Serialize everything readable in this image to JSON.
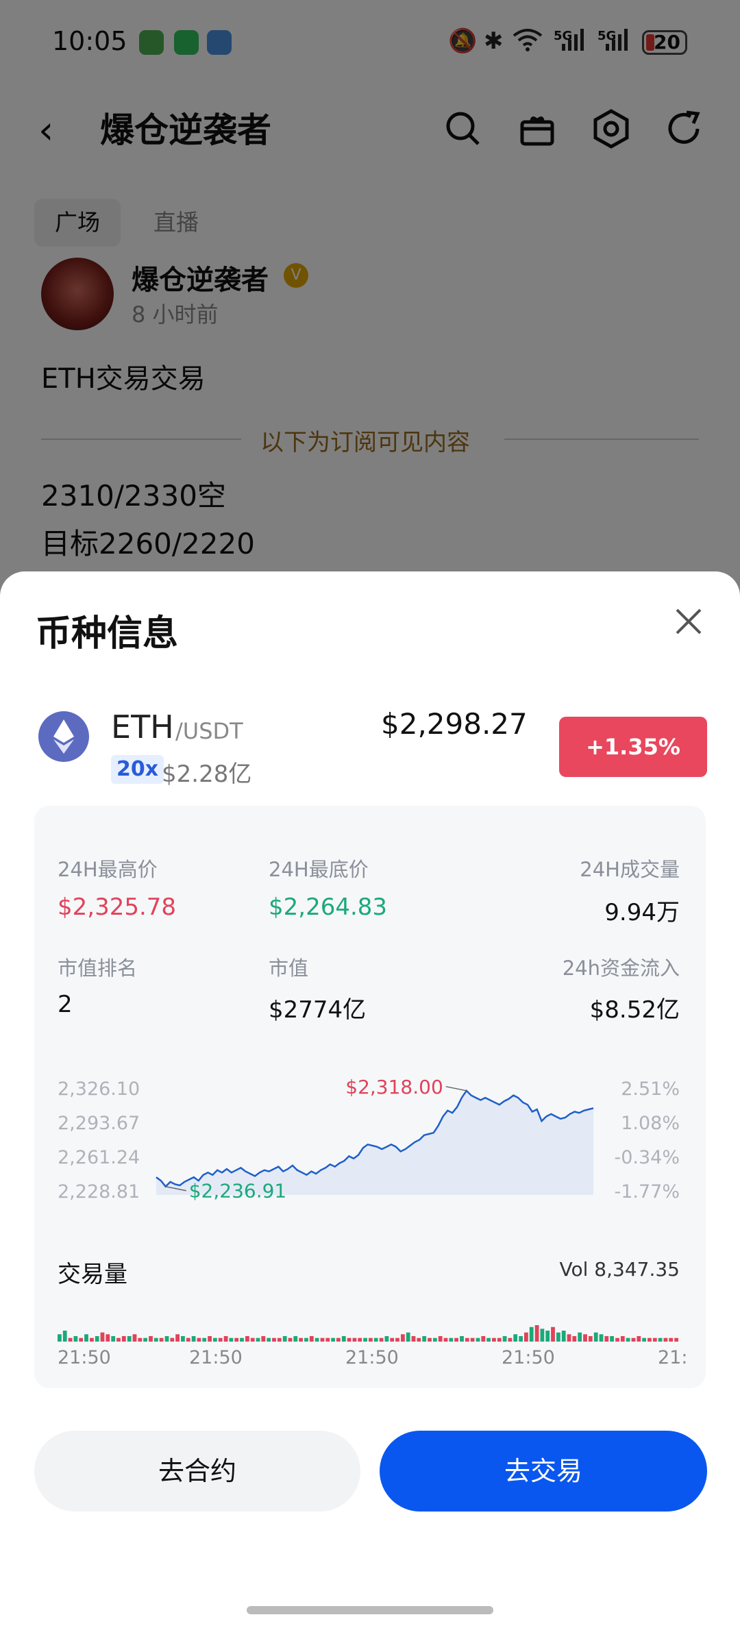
{
  "status": {
    "time": "10:05",
    "net1": "5G",
    "net2": "5G",
    "battery": "20"
  },
  "nav": {
    "back": "‹",
    "title": "爆仓逆袭者"
  },
  "tabs": [
    "广场",
    "直播"
  ],
  "post": {
    "author": "爆仓逆袭者",
    "time": "8 小时前",
    "title": "ETH交易交易",
    "subscriber_label": "以下为订阅可见内容",
    "line1": "2310/2330空",
    "line2": "目标2260/2220"
  },
  "sheet": {
    "title": "币种信息",
    "coin": {
      "symbol": "ETH",
      "pair": "/USDT",
      "leverage": "20x",
      "volume": "$2.28亿",
      "price": "$2,298.27",
      "change": "+1.35%"
    },
    "stats": {
      "high_label": "24H最高价",
      "high_value": "$2,325.78",
      "low_label": "24H最底价",
      "low_value": "$2,264.83",
      "vol_label": "24H成交量",
      "vol_value": "9.94万",
      "rank_label": "市值排名",
      "rank_value": "2",
      "cap_label": "市值",
      "cap_value": "$2774亿",
      "inflow_label": "24h资金流入",
      "inflow_value": "$8.52亿"
    },
    "volume_section": {
      "title": "交易量",
      "total": "Vol 8,347.35"
    },
    "buttons": {
      "contract": "去合约",
      "trade": "去交易"
    }
  },
  "colors": {
    "up": "#e0435a",
    "down": "#1ba97a",
    "primary": "#0a57f0",
    "line": "#1f5fc8"
  },
  "chart_data": [
    {
      "type": "line",
      "y_ticks_left": [
        "2,326.10",
        "2,293.67",
        "2,261.24",
        "2,228.81"
      ],
      "y_ticks_right": [
        "2.51%",
        "1.08%",
        "-0.34%",
        "-1.77%"
      ],
      "ylim": [
        2228.81,
        2326.1
      ],
      "annotations": [
        {
          "text": "$2,318.00",
          "kind": "high"
        },
        {
          "text": "$2,236.91",
          "kind": "low"
        }
      ],
      "series": [
        {
          "values": [
            2244,
            2241,
            2236,
            2240,
            2238,
            2237,
            2240,
            2242,
            2244,
            2241,
            2246,
            2248,
            2246,
            2250,
            2248,
            2251,
            2248,
            2250,
            2252,
            2249,
            2247,
            2245,
            2248,
            2250,
            2249,
            2251,
            2253,
            2249,
            2251,
            2254,
            2250,
            2248,
            2246,
            2249,
            2247,
            2250,
            2252,
            2255,
            2253,
            2256,
            2258,
            2262,
            2260,
            2263,
            2269,
            2272,
            2271,
            2270,
            2268,
            2270,
            2272,
            2270,
            2266,
            2268,
            2271,
            2274,
            2276,
            2280,
            2281,
            2282,
            2288,
            2296,
            2301,
            2299,
            2304,
            2312,
            2318,
            2314,
            2312,
            2310,
            2312,
            2310,
            2308,
            2306,
            2309,
            2311,
            2314,
            2312,
            2308,
            2306,
            2300,
            2302,
            2292,
            2296,
            2298,
            2296,
            2294,
            2295,
            2298,
            2300,
            2299,
            2301,
            2302,
            2303
          ]
        }
      ]
    },
    {
      "type": "bar",
      "x_ticks": [
        "21:50",
        "21:50",
        "21:50",
        "21:50",
        "21:"
      ],
      "series": [
        {
          "name": "Vol",
          "values": [
            4,
            6,
            2,
            3,
            2,
            4,
            2,
            3,
            5,
            4,
            3,
            2,
            3,
            3,
            4,
            2,
            2,
            3,
            2,
            2,
            3,
            2,
            4,
            3,
            2,
            3,
            2,
            2,
            3,
            2,
            2,
            3,
            2,
            2,
            2,
            3,
            2,
            2,
            3,
            2,
            2,
            2,
            3,
            2,
            3,
            2,
            2,
            3,
            2,
            2,
            2,
            2,
            2,
            3,
            2,
            2,
            2,
            2,
            2,
            2,
            2,
            3,
            2,
            2,
            4,
            5,
            3,
            2,
            3,
            2,
            2,
            3,
            2,
            2,
            2,
            3,
            2,
            2,
            2,
            3,
            2,
            2,
            2,
            3,
            2,
            4,
            3,
            5,
            8,
            9,
            7,
            6,
            8,
            5,
            6,
            4,
            3,
            5,
            4,
            3,
            5,
            4,
            3,
            3,
            2,
            3,
            2,
            2,
            3,
            2,
            2,
            2,
            2,
            2,
            2,
            2
          ]
        }
      ],
      "up_down": [
        1,
        1,
        0,
        1,
        0,
        1,
        0,
        1,
        0,
        0,
        1,
        0,
        0,
        1,
        0,
        0,
        1,
        0,
        1,
        0,
        1,
        0,
        0,
        1,
        0,
        1,
        0,
        1,
        0,
        1,
        0,
        0,
        1,
        0,
        1,
        0,
        0,
        1,
        0,
        1,
        0,
        0,
        1,
        0,
        1,
        0,
        1,
        0,
        1,
        0,
        0,
        1,
        0,
        1,
        0,
        0,
        0,
        1,
        0,
        1,
        0,
        1,
        0,
        0,
        0,
        1,
        0,
        0,
        1,
        0,
        1,
        0,
        0,
        1,
        0,
        1,
        0,
        0,
        1,
        0,
        1,
        0,
        0,
        1,
        0,
        1,
        1,
        0,
        1,
        0,
        1,
        1,
        0,
        1,
        1,
        0,
        0,
        1,
        0,
        0,
        1,
        1,
        0,
        1,
        0,
        0,
        1,
        0,
        0,
        1,
        0,
        0,
        1,
        0,
        0,
        0
      ]
    }
  ]
}
